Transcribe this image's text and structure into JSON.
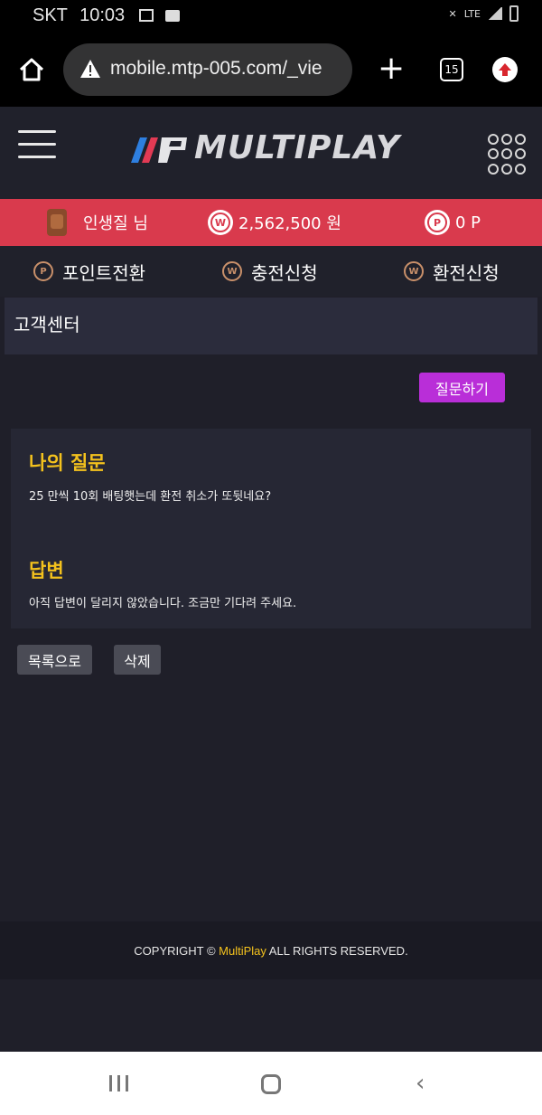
{
  "status_bar": {
    "carrier": "SKT",
    "time": "10:03",
    "network": "LTE"
  },
  "browser": {
    "url": "mobile.mtp-005.com/_vie",
    "tab_count": "15"
  },
  "site": {
    "logo_text": "MULTIPLAY"
  },
  "user_bar": {
    "username": "인생질 님",
    "balance_icon": "W",
    "balance": "2,562,500 원",
    "points_icon": "P",
    "points": "0 P"
  },
  "menu": [
    {
      "icon": "P",
      "label": "포인트전환"
    },
    {
      "icon": "W",
      "label": "충전신청"
    },
    {
      "icon": "W",
      "label": "환전신청"
    }
  ],
  "page": {
    "title": "고객센터",
    "ask_button": "질문하기",
    "question_heading": "나의 질문",
    "question_text": "25 만씩 10회 배팅햇는데 환전 취소가 또뒷네요?",
    "answer_heading": "답변",
    "answer_text": "아직 답변이 달리지 않았습니다. 조금만 기다려 주세요.",
    "list_button": "목록으로",
    "delete_button": "삭제"
  },
  "footer": {
    "prefix": "COPYRIGHT © ",
    "brand": "MultiPlay",
    "suffix": " ALL RIGHTS RESERVED."
  },
  "colors": {
    "accent_red": "#d93a4d",
    "accent_purple": "#b92ed8",
    "heading_yellow": "#f4c21d",
    "background": "#1f1f29"
  }
}
